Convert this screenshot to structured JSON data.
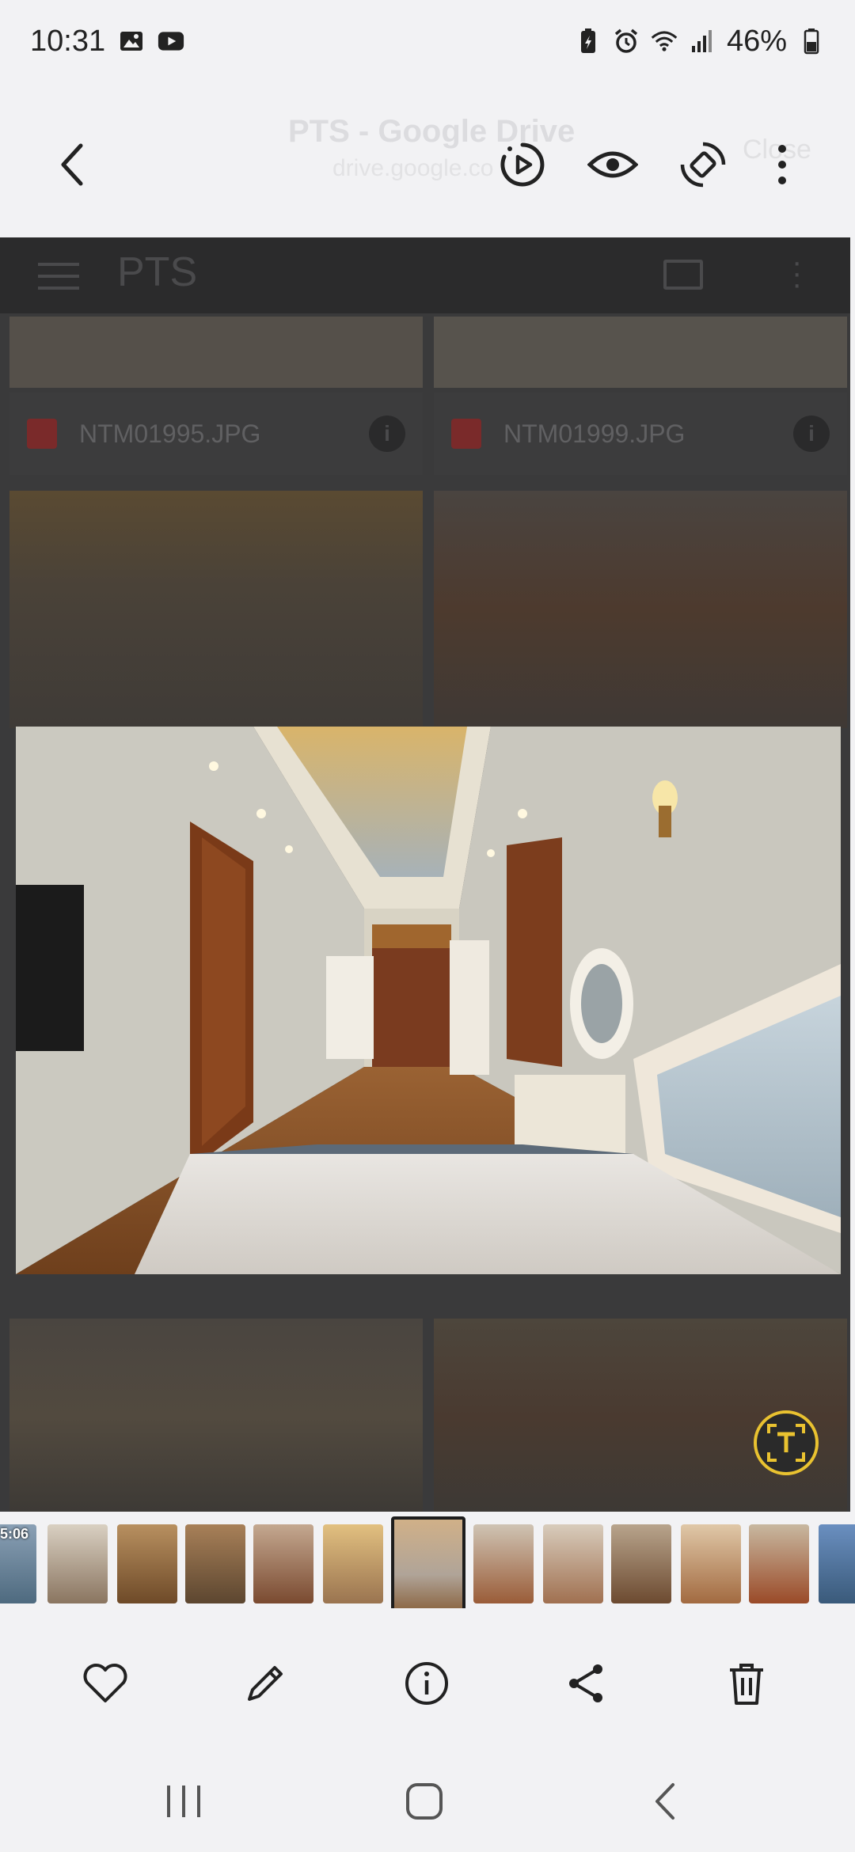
{
  "status_bar": {
    "time": "10:31",
    "battery": "46%",
    "icons": [
      "gallery-icon",
      "youtube-icon",
      "battery-saver-icon",
      "alarm-icon",
      "wifi-icon",
      "signal-icon",
      "battery-icon"
    ]
  },
  "background_page": {
    "browser_title": "PTS - Google Drive",
    "browser_url": "drive.google.co",
    "close_label": "Close",
    "drive_title": "PTS",
    "files": [
      {
        "name": "NTM01995.JPG"
      },
      {
        "name": "NTM01999.JPG"
      }
    ]
  },
  "toolbar": {
    "back": "back-icon",
    "actions": [
      "motion-photo-icon",
      "eye-icon",
      "rotate-icon",
      "more-vert-icon"
    ]
  },
  "filmstrip": {
    "first_thumb_time": "5:06",
    "thumb_count": 13,
    "active_index": 6
  },
  "bottom_actions": [
    "favorite-icon",
    "edit-icon",
    "details-icon",
    "share-icon",
    "delete-icon"
  ],
  "nav": [
    "recents-icon",
    "home-icon",
    "back-icon"
  ],
  "colors": {
    "accent_ocr": "#e9c230",
    "background": "#f2f2f4"
  }
}
